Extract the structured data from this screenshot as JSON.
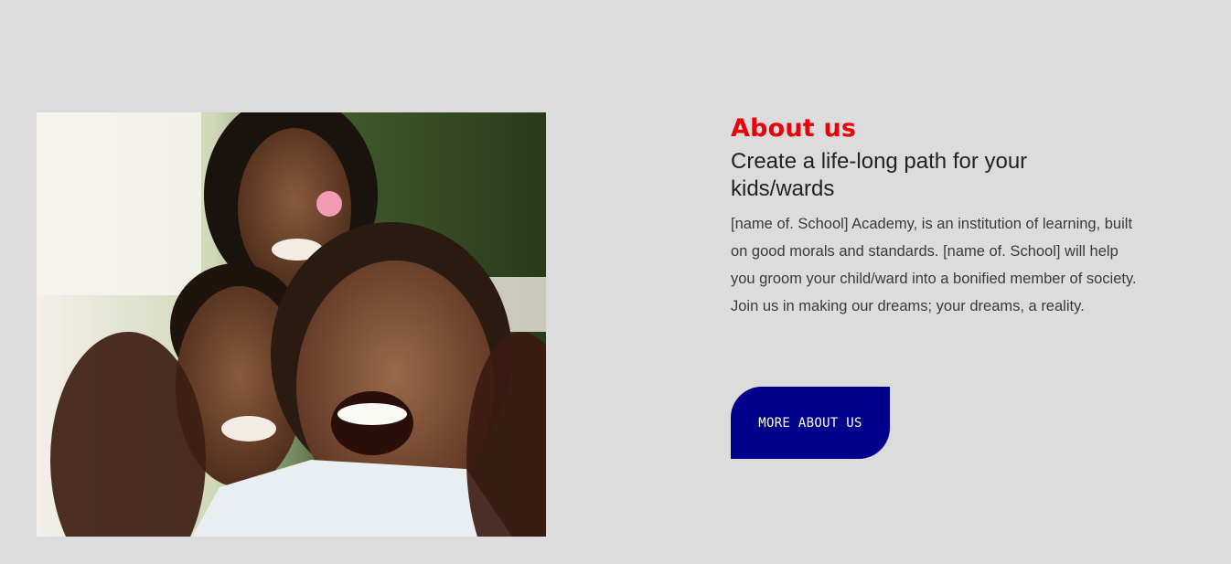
{
  "about": {
    "eyebrow": "About us",
    "headline": "Create a life-long path for your kids/wards",
    "body": "[name of. School] Academy, is an institution of learning, built on good morals and standards. [name of. School] will help you groom your child/ward into a bonified member of society. Join us in making our dreams; your dreams, a reality.",
    "cta_label": "MORE ABOUT US"
  },
  "colors": {
    "background": "#dcdcdc",
    "eyebrow": "#e8000b",
    "cta_background": "#00008b",
    "cta_text": "#ffffff"
  },
  "image": {
    "subject": "smiling-children-selfie-photo"
  }
}
